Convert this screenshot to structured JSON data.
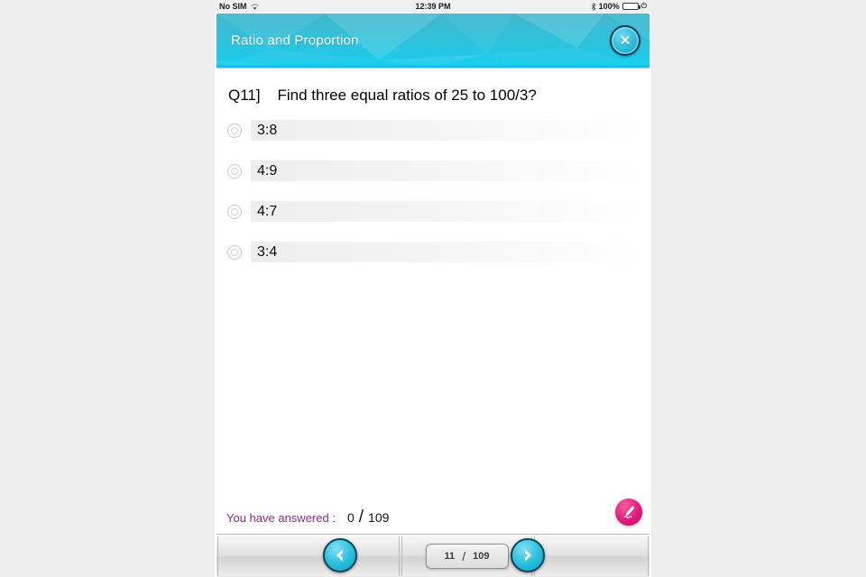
{
  "status_bar": {
    "carrier": "No SIM",
    "wifi_icon": "wifi-icon",
    "time": "12:39 PM",
    "bluetooth_icon": "bluetooth-icon",
    "battery_percent": "100%",
    "battery_icon": "battery-icon",
    "charging_icon": "charging-plug-icon"
  },
  "header": {
    "title": "Ratio and Proportion",
    "close_icon": "close-icon",
    "close_glyph": "✕",
    "bg_color_top": "#3fb7cf",
    "bg_color_bottom": "#19c8e8",
    "accent_color": "#17c0e0"
  },
  "question": {
    "number": "Q11]",
    "text": "Find three equal ratios of 25 to 100/3?",
    "full": "Q11]    Find three equal ratios of 25 to 100/3?"
  },
  "options": [
    {
      "label": "3:8",
      "selected": false
    },
    {
      "label": "4:9",
      "selected": false
    },
    {
      "label": "4:7",
      "selected": false
    },
    {
      "label": "3:4",
      "selected": false
    }
  ],
  "answered": {
    "label": "You have answered :",
    "count": "0",
    "separator": "/",
    "total": "109",
    "label_color": "#8b2a8b"
  },
  "pencil_button": {
    "icon": "pencil-icon",
    "color": "#e0157c"
  },
  "toolbar": {
    "prev_icon": "chevron-left-icon",
    "next_icon": "chevron-right-icon",
    "page_current": "11",
    "page_separator": "/",
    "page_total": "109",
    "button_color": "#2bbfdf"
  }
}
